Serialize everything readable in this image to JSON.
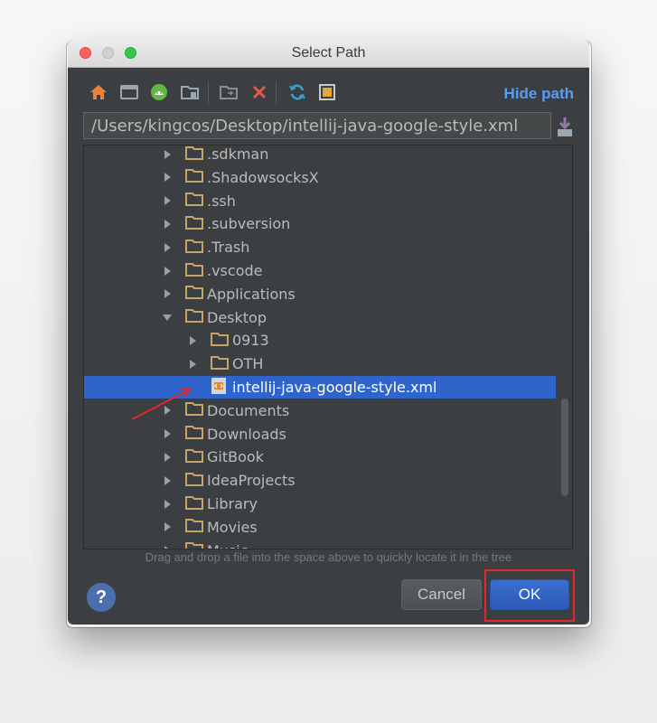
{
  "window": {
    "title": "Select Path"
  },
  "toolbar": {
    "icons": [
      "home-icon",
      "desktop-icon",
      "android-icon",
      "new-folder-icon",
      "move-icon",
      "delete-icon",
      "refresh-icon",
      "show-hidden-icon"
    ],
    "hide_path_label": "Hide path"
  },
  "path": {
    "value": "/Users/kingcos/Desktop/intellij-java-google-style.xml"
  },
  "tree": {
    "items": [
      {
        "label": ".sdkman",
        "type": "folder",
        "expanded": false
      },
      {
        "label": ".ShadowsocksX",
        "type": "folder",
        "expanded": false
      },
      {
        "label": ".ssh",
        "type": "folder",
        "expanded": false
      },
      {
        "label": ".subversion",
        "type": "folder",
        "expanded": false
      },
      {
        "label": ".Trash",
        "type": "folder",
        "expanded": false
      },
      {
        "label": ".vscode",
        "type": "folder",
        "expanded": false
      },
      {
        "label": "Applications",
        "type": "folder",
        "expanded": false
      },
      {
        "label": "Desktop",
        "type": "folder",
        "expanded": true
      },
      {
        "label": "0913",
        "type": "folder",
        "expanded": false
      },
      {
        "label": "OTH",
        "type": "folder",
        "expanded": false
      },
      {
        "label": "intellij-java-google-style.xml",
        "type": "file",
        "selected": true
      },
      {
        "label": "Documents",
        "type": "folder",
        "expanded": false
      },
      {
        "label": "Downloads",
        "type": "folder",
        "expanded": false
      },
      {
        "label": "GitBook",
        "type": "folder",
        "expanded": false
      },
      {
        "label": "IdeaProjects",
        "type": "folder",
        "expanded": false
      },
      {
        "label": "Library",
        "type": "folder",
        "expanded": false
      },
      {
        "label": "Movies",
        "type": "folder",
        "expanded": false
      },
      {
        "label": "Music",
        "type": "folder",
        "expanded": false
      }
    ]
  },
  "hint": "Drag and drop a file into the space above to quickly locate it in the tree",
  "buttons": {
    "help": "?",
    "cancel": "Cancel",
    "ok": "OK"
  },
  "colors": {
    "accent": "#2f65ca",
    "link": "#589df6",
    "annotation": "#e3282a",
    "folder": "#c9a46a"
  }
}
